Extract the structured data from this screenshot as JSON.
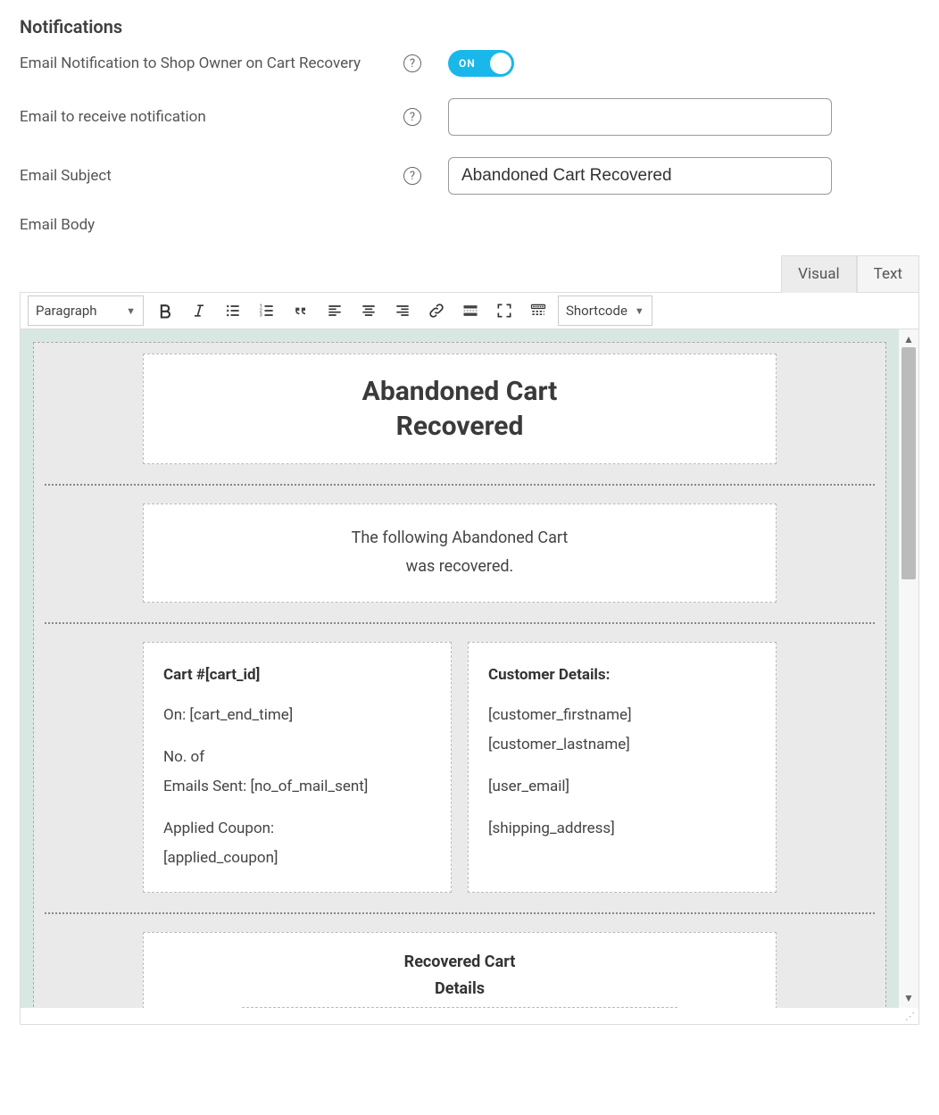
{
  "section_title": "Notifications",
  "fields": {
    "enable": {
      "label": "Email Notification to Shop Owner on Cart Recovery",
      "toggle_label": "ON"
    },
    "recipient": {
      "label": "Email to receive notification",
      "value": ""
    },
    "subject": {
      "label": "Email Subject",
      "value": "Abandoned Cart Recovered"
    },
    "body": {
      "label": "Email Body"
    }
  },
  "editor": {
    "tabs": {
      "visual": "Visual",
      "text": "Text",
      "active": "visual"
    },
    "format_select": "Paragraph",
    "shortcode_select": "Shortcode"
  },
  "template": {
    "title_line1": "Abandoned Cart",
    "title_line2": "Recovered",
    "intro_line1": "The following Abandoned Cart",
    "intro_line2": "was recovered.",
    "cart": {
      "heading": "Cart #[cart_id]",
      "l1": "On: [cart_end_time]",
      "l2a": "No. of",
      "l2b": "Emails Sent: [no_of_mail_sent]",
      "l3a": "Applied Coupon:",
      "l3b": "[applied_coupon]"
    },
    "customer": {
      "heading": "Customer Details:",
      "l1": "[customer_firstname]",
      "l2": "[customer_lastname]",
      "l3": "[user_email]",
      "l4": "[shipping_address]"
    },
    "recovered_title_l1": "Recovered Cart",
    "recovered_title_l2": "Details"
  }
}
